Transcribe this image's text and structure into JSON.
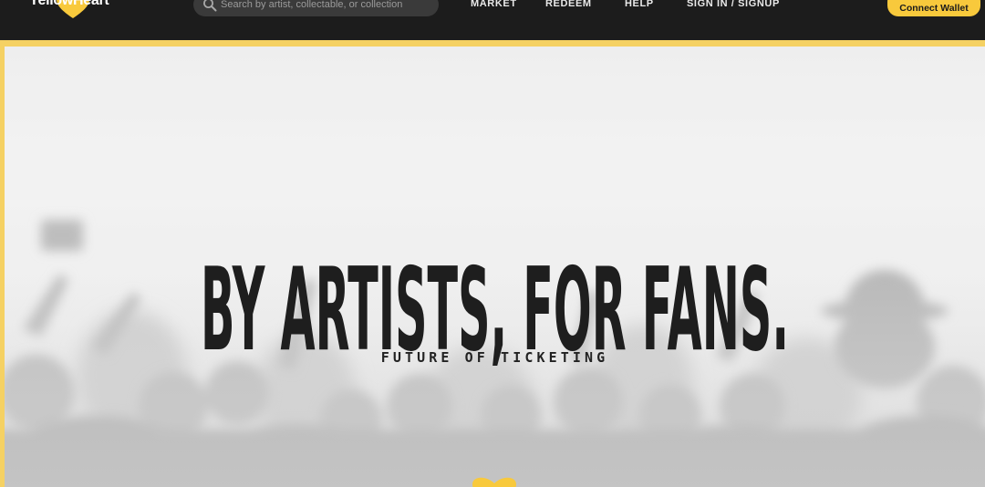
{
  "header": {
    "logo_text": "YellowHeart",
    "search_placeholder": "Search by artist, collectable, or collection",
    "nav": {
      "market": "MARKET",
      "redeem": "REDEEM",
      "help": "HELP",
      "sign_in": "SIGN IN / SIGNUP"
    },
    "connect_wallet": "Connect Wallet"
  },
  "hero": {
    "headline": "BY ARTISTS, FOR FANS.",
    "subheadline": "FUTURE OF TICKETING"
  },
  "colors": {
    "brand_yellow": "#f8c93c",
    "frame_yellow": "#f5d163",
    "nav_background": "#1c1c1c",
    "headline": "#1e1e1e"
  },
  "icons": {
    "logo": "heart-icon",
    "search": "search-icon",
    "scroll_indicator": "heart-icon"
  }
}
